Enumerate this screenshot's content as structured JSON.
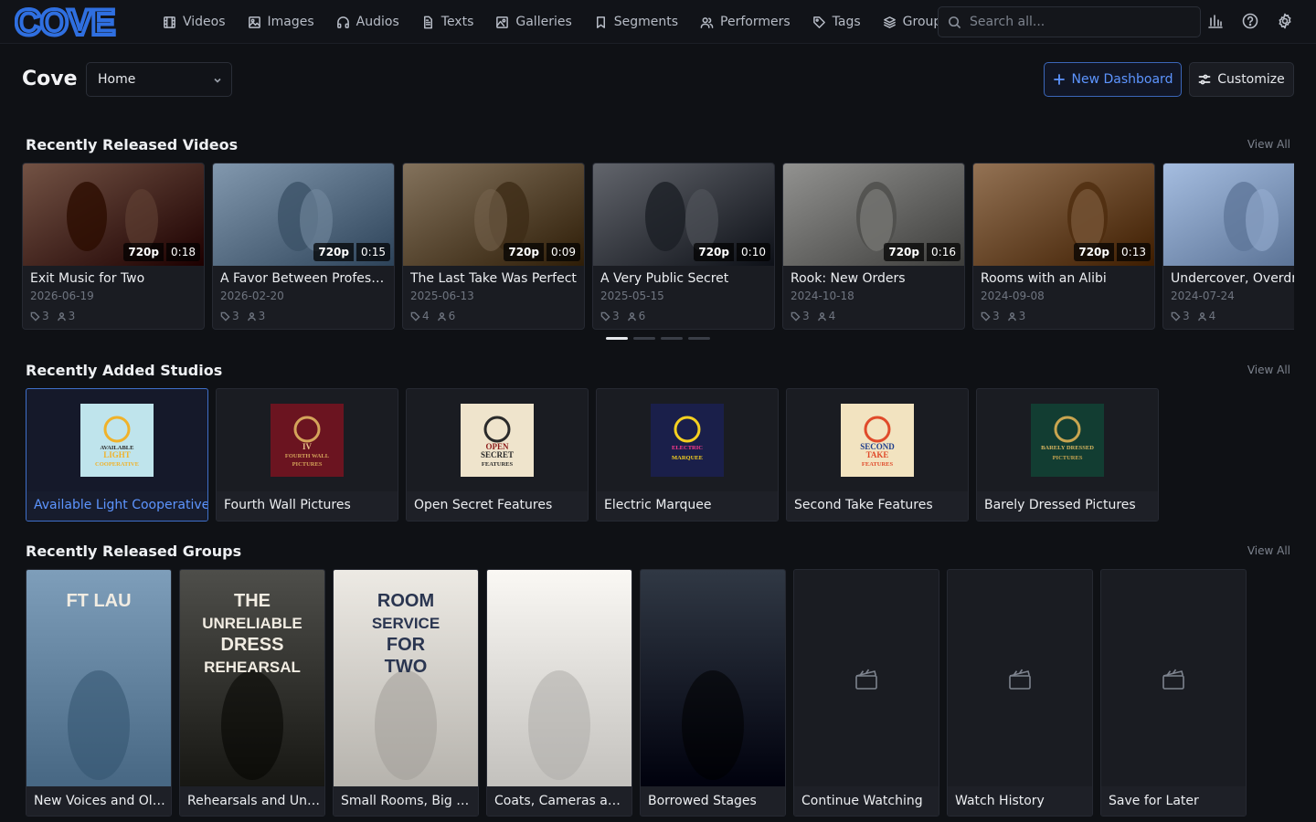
{
  "app": {
    "name": "COVE"
  },
  "nav": [
    {
      "label": "Videos",
      "icon": "film-icon"
    },
    {
      "label": "Images",
      "icon": "image-icon"
    },
    {
      "label": "Audios",
      "icon": "headphones-icon"
    },
    {
      "label": "Texts",
      "icon": "document-icon"
    },
    {
      "label": "Galleries",
      "icon": "gallery-icon"
    },
    {
      "label": "Segments",
      "icon": "bookmark-icon"
    },
    {
      "label": "Performers",
      "icon": "users-icon"
    },
    {
      "label": "Tags",
      "icon": "tag-icon"
    },
    {
      "label": "Group",
      "icon": "layers-icon"
    }
  ],
  "search": {
    "placeholder": "Search all..."
  },
  "header": {
    "title": "Cove",
    "dashboard_selected": "Home",
    "new_dashboard_label": "New Dashboard",
    "customize_label": "Customize"
  },
  "sections": {
    "videos": {
      "title": "Recently Released Videos",
      "view_all": "View All"
    },
    "studios": {
      "title": "Recently Added Studios",
      "view_all": "View All"
    },
    "groups": {
      "title": "Recently Released Groups",
      "view_all": "View All"
    }
  },
  "videos": [
    {
      "title": "Exit Music for Two",
      "date": "2026-06-19",
      "res": "720p",
      "duration": "0:18",
      "tags": "3",
      "performers": "3",
      "theme": "#4a2a1c"
    },
    {
      "title": "A Favor Between Professi...",
      "date": "2026-02-20",
      "res": "720p",
      "duration": "0:15",
      "tags": "3",
      "performers": "3",
      "theme": "#5a7086"
    },
    {
      "title": "The Last Take Was Perfect",
      "date": "2025-06-13",
      "res": "720p",
      "duration": "0:09",
      "tags": "4",
      "performers": "6",
      "theme": "#5b4a34"
    },
    {
      "title": "A Very Public Secret",
      "date": "2025-05-15",
      "res": "720p",
      "duration": "0:10",
      "tags": "3",
      "performers": "6",
      "theme": "#3a3d44"
    },
    {
      "title": "Rook: New Orders",
      "date": "2024-10-18",
      "res": "720p",
      "duration": "0:16",
      "tags": "3",
      "performers": "4",
      "theme": "#6a6a68"
    },
    {
      "title": "Rooms with an Alibi",
      "date": "2024-09-08",
      "res": "720p",
      "duration": "0:13",
      "tags": "3",
      "performers": "3",
      "theme": "#6b4a2c"
    },
    {
      "title": "Undercover, Overdre",
      "date": "2024-07-24",
      "res": "720p",
      "duration": "",
      "tags": "3",
      "performers": "4",
      "theme": "#7d95b8"
    }
  ],
  "studios": [
    {
      "name": "Available Light Cooperative",
      "logo_bg": "#bfe4ec",
      "logo_fg": "#2a2a2a",
      "logo_accent": "#f0b22a",
      "logo_lines": [
        "AVAILABLE",
        "LIGHT",
        "COOPERATIVE"
      ]
    },
    {
      "name": "Fourth Wall Pictures",
      "logo_bg": "#6b1420",
      "logo_fg": "#e8c38a",
      "logo_accent": "#d4a45a",
      "logo_lines": [
        "IV",
        "FOURTH WALL",
        "PICTURES"
      ]
    },
    {
      "name": "Open Secret Features",
      "logo_bg": "#efe4cc",
      "logo_fg": "#8b1a1a",
      "logo_accent": "#2a2a2a",
      "logo_lines": [
        "OPEN",
        "SECRET",
        "FEATURES"
      ]
    },
    {
      "name": "Electric Marquee",
      "logo_bg": "#1a1f4a",
      "logo_fg": "#ff3a8c",
      "logo_accent": "#f5d020",
      "logo_lines": [
        "ELECTRIC",
        "MARQUEE"
      ]
    },
    {
      "name": "Second Take Features",
      "logo_bg": "#f2e3c0",
      "logo_fg": "#1e3d8c",
      "logo_accent": "#e04a2a",
      "logo_lines": [
        "SECOND",
        "TAKE",
        "FEATURES"
      ]
    },
    {
      "name": "Barely Dressed Pictures",
      "logo_bg": "#123d32",
      "logo_fg": "#d8b660",
      "logo_accent": "#c9a550",
      "logo_lines": [
        "BARELY DRESSED",
        "PICTURES"
      ]
    }
  ],
  "groups": [
    {
      "name": "New Voices and Old...",
      "theme": "#6a8aa6",
      "poster_lines": [
        "FT LAU"
      ]
    },
    {
      "name": "Rehearsals and Unr...",
      "theme": "#3a3a36",
      "poster_lines": [
        "THE",
        "UNRELIABLE",
        "DRESS",
        "REHEARSAL"
      ]
    },
    {
      "name": "Small Rooms, Big A...",
      "theme": "#d9d6d0",
      "poster_lines": [
        "ROOM",
        "SERVICE",
        "FOR",
        "TWO"
      ]
    },
    {
      "name": "Coats, Cameras and...",
      "theme": "#e6e4e0",
      "poster_lines": []
    },
    {
      "name": "Borrowed Stages",
      "theme": "#1c2430",
      "poster_lines": []
    },
    {
      "name": "Continue Watching",
      "theme": "",
      "poster_lines": []
    },
    {
      "name": "Watch History",
      "theme": "",
      "poster_lines": []
    },
    {
      "name": "Save for Later",
      "theme": "",
      "poster_lines": []
    }
  ],
  "colors": {
    "accent": "#5d95ff",
    "background": "#0f1115",
    "card": "#1a1c22"
  }
}
